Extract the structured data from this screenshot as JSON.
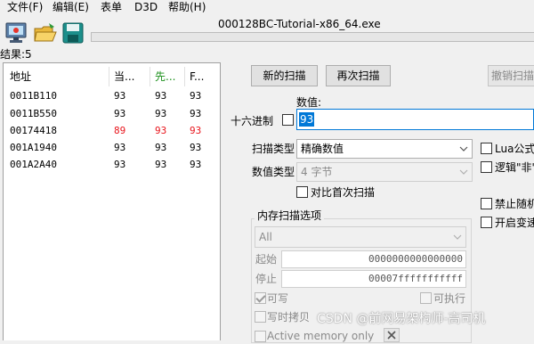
{
  "menu": [
    "文件(F)",
    "编辑(E)",
    "表单",
    "D3D",
    "帮助(H)"
  ],
  "window_title": "000128BC-Tutorial-x86_64.exe",
  "toolbar_icons": [
    "computer-icon",
    "open-folder-icon",
    "save-disk-icon"
  ],
  "results_label": "结果:5",
  "result_columns": [
    "地址",
    "当...",
    "先...",
    "F..."
  ],
  "result_rows": [
    {
      "address": "0011B110",
      "current": "93",
      "previous": "93",
      "first": "93",
      "changed": false
    },
    {
      "address": "0011B550",
      "current": "93",
      "previous": "93",
      "first": "93",
      "changed": false
    },
    {
      "address": "00174418",
      "current": "89",
      "previous": "93",
      "first": "93",
      "changed": true
    },
    {
      "address": "001A1940",
      "current": "93",
      "previous": "93",
      "first": "93",
      "changed": false
    },
    {
      "address": "001A2A40",
      "current": "93",
      "previous": "93",
      "first": "93",
      "changed": false
    }
  ],
  "buttons": {
    "new_scan": "新的扫描",
    "next_scan": "再次扫描",
    "undo_scan": "撤销扫描"
  },
  "value_label": "数值:",
  "hex_label": "十六进制",
  "value_input": "93",
  "scan_type_label": "扫描类型",
  "scan_type_value": "精确数值",
  "value_type_label": "数值类型",
  "value_type_value": "4 字节",
  "compare_first_label": "对比首次扫描",
  "right_options": {
    "lua": "Lua公式",
    "logic_not": "逻辑\"非\"",
    "disable_random": "禁止随机",
    "enable_speedhack": "开启变速"
  },
  "memory_options": {
    "title": "内存扫描选项",
    "region": "All",
    "start_label": "起始",
    "start_value": "0000000000000000",
    "stop_label": "停止",
    "stop_value": "00007fffffffffff",
    "writable": "可写",
    "executable": "可执行",
    "copy_on_write": "写时拷贝",
    "active_memory_only": "Active memory only"
  },
  "watermark": "CSDN @前网易架构师-高司机",
  "colors": {
    "changed_value": "#e8141b",
    "previous_header": "#1a8f1a",
    "selection": "#0078d7"
  }
}
